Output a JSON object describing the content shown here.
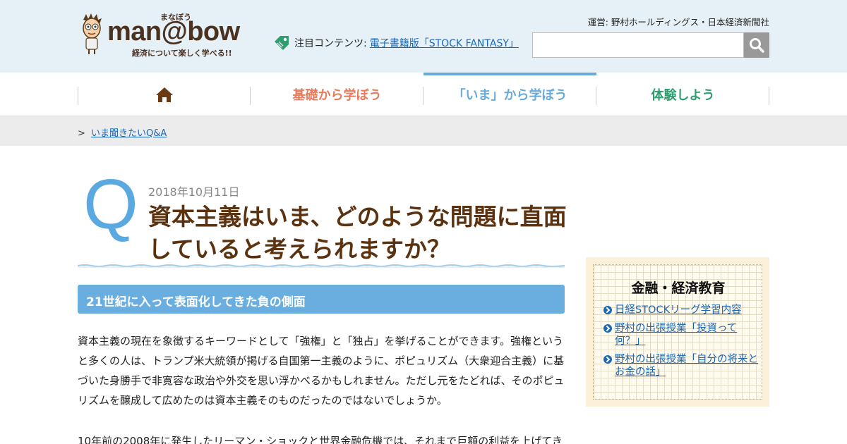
{
  "header": {
    "logo_text": "man@bow",
    "logo_ruby": "まなぼう",
    "logo_tagline": "経済について楽しく学べる!!",
    "operator": "運営: 野村ホールディングス・日本経済新聞社",
    "notice_label": "注目コンテンツ:",
    "notice_link": "電子書籍版「STOCK FANTASY」",
    "search_placeholder": "",
    "search_icon": "search-icon"
  },
  "nav": {
    "home_icon": "home-icon",
    "items": [
      {
        "label": "基礎から学ぼう",
        "color": "#e87a5d"
      },
      {
        "label": "「いま」から学ぼう",
        "color": "#6aaad8"
      },
      {
        "label": "体験しよう",
        "color": "#2f9e6e"
      }
    ]
  },
  "breadcrumb": {
    "separator": ">",
    "link": "いま聞きたいQ&A"
  },
  "article": {
    "q_mark": "Q",
    "date": "2018年10月11日",
    "title": "資本主義はいま、どのような問題に直面していると考えられますか？",
    "section_heading": "21世紀に入って表面化してきた負の側面",
    "paragraph1": "資本主義の現在を象徴するキーワードとして「強権」と「独占」を挙げることができます。強権というと多くの人は、トランプ米大統領が掲げる自国第一主義のように、ポピュリズム（大衆迎合主義）に基づいた身勝手で非寛容な政治や外交を思い浮かべるかもしれません。ただし元をたどれば、そのポピュリズムを醸成して広めたのは資本主義そのものだったのではないでしょうか。",
    "paragraph2": "10年前の2008年に発生したリーマン・ショックと世界金融危機では、それまで巨額の利益を上げてき"
  },
  "sidebar": {
    "title": "金融・経済教育",
    "links": [
      "日経STOCKリーグ学習内容",
      "野村の出張授業「投資って何？」",
      "野村の出張授業「自分の将来とお金の話」"
    ]
  },
  "colors": {
    "header_bg": "#e6f0f7",
    "accent_blue": "#6aaee0",
    "title_brown": "#5b3210",
    "link_blue": "#1d67b5"
  }
}
